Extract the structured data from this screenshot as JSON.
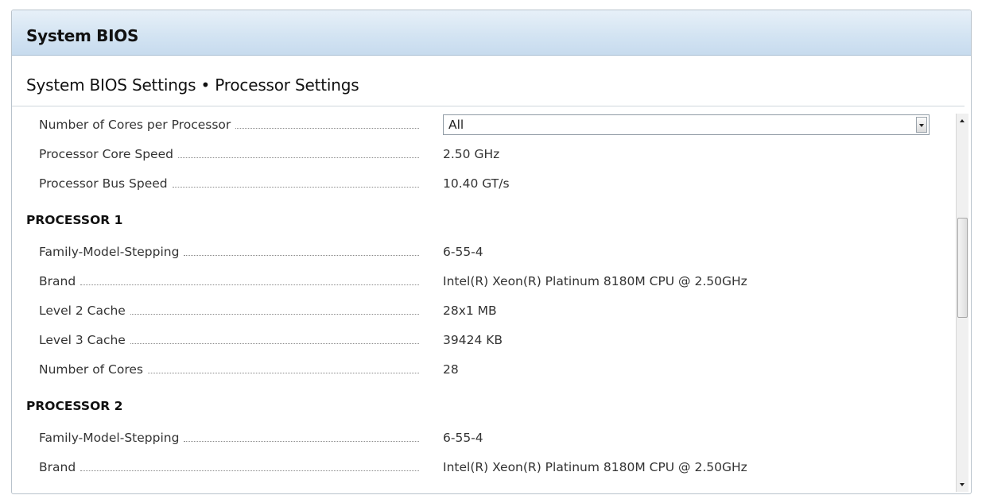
{
  "header": {
    "title": "System BIOS"
  },
  "breadcrumb": "System BIOS Settings • Processor Settings",
  "settings": {
    "cores_per_processor": {
      "label": "Number of Cores per Processor",
      "value": "All"
    },
    "core_speed": {
      "label": "Processor Core Speed",
      "value": "2.50 GHz"
    },
    "bus_speed": {
      "label": "Processor Bus Speed",
      "value": "10.40 GT/s"
    }
  },
  "processor1": {
    "heading": "PROCESSOR 1",
    "rows": [
      {
        "label": "Family-Model-Stepping",
        "value": "6-55-4"
      },
      {
        "label": "Brand",
        "value": "Intel(R) Xeon(R) Platinum 8180M CPU @ 2.50GHz"
      },
      {
        "label": "Level 2 Cache",
        "value": "28x1 MB"
      },
      {
        "label": "Level 3 Cache",
        "value": "39424 KB"
      },
      {
        "label": "Number of Cores",
        "value": "28"
      }
    ]
  },
  "processor2": {
    "heading": "PROCESSOR 2",
    "rows": [
      {
        "label": "Family-Model-Stepping",
        "value": "6-55-4"
      },
      {
        "label": "Brand",
        "value": "Intel(R) Xeon(R) Platinum 8180M CPU @ 2.50GHz"
      }
    ]
  },
  "scrollbar": {
    "position_fraction": 0.36
  }
}
